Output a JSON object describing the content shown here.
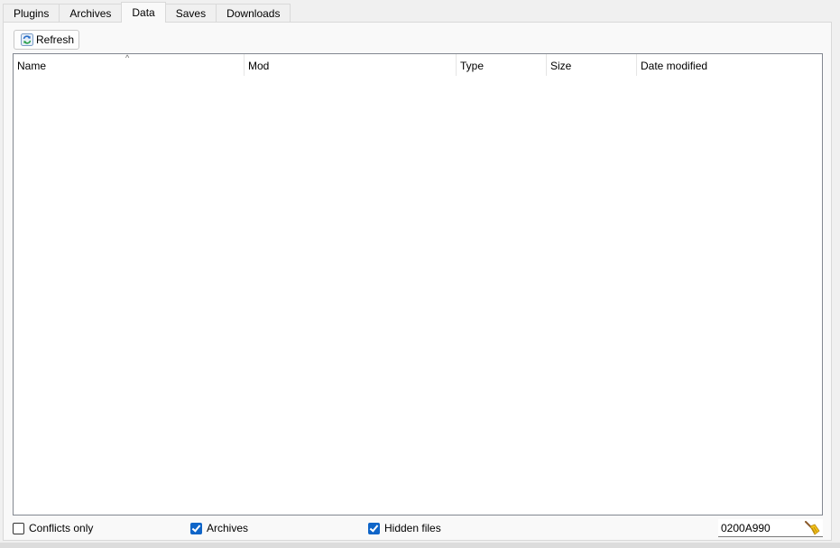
{
  "tabs": [
    {
      "label": "Plugins",
      "active": false
    },
    {
      "label": "Archives",
      "active": false
    },
    {
      "label": "Data",
      "active": true
    },
    {
      "label": "Saves",
      "active": false
    },
    {
      "label": "Downloads",
      "active": false
    }
  ],
  "toolbar": {
    "refresh_label": "Refresh"
  },
  "table": {
    "columns": [
      {
        "label": "Name"
      },
      {
        "label": "Mod"
      },
      {
        "label": "Type"
      },
      {
        "label": "Size"
      },
      {
        "label": "Date modified"
      }
    ],
    "sort_indicator": "^",
    "rows": []
  },
  "filters": {
    "conflicts_only": {
      "label": "Conflicts only",
      "checked": false
    },
    "archives": {
      "label": "Archives",
      "checked": true
    },
    "hidden_files": {
      "label": "Hidden files",
      "checked": true
    }
  },
  "filter_input": {
    "value": "0200A990"
  },
  "icons": {
    "refresh": "refresh-icon",
    "clear": "broom-icon"
  },
  "colors": {
    "checkbox_accent": "#0f65c8"
  }
}
